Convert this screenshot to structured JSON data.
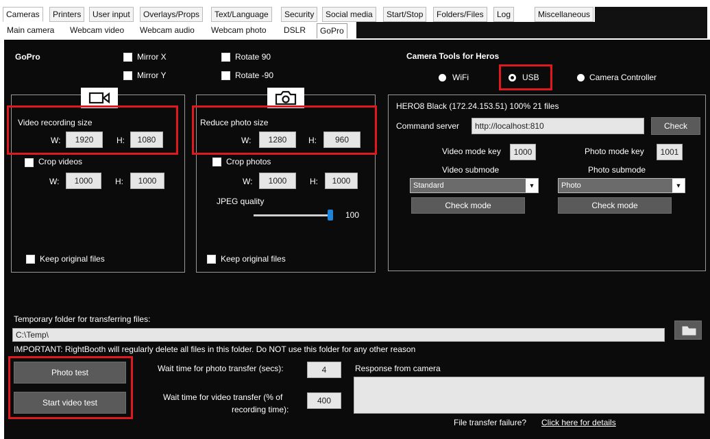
{
  "tabs_top": [
    "Cameras",
    "Printers",
    "User input",
    "Overlays/Props",
    "Text/Language",
    "Security",
    "Social media",
    "Start/Stop",
    "Folders/Files",
    "Log",
    "Miscellaneous"
  ],
  "tabs_sub": [
    "Main camera",
    "Webcam video",
    "Webcam audio",
    "Webcam photo",
    "DSLR",
    "GoPro"
  ],
  "gopro": {
    "title": "GoPro",
    "mirror_x": "Mirror X",
    "mirror_y": "Mirror Y",
    "rotate_90": "Rotate 90",
    "rotate_m90": "Rotate -90"
  },
  "video": {
    "size_label": "Video recording size",
    "w_label": "W:",
    "w_value": "1920",
    "h_label": "H:",
    "h_value": "1080",
    "crop_label": "Crop videos",
    "crop_w_label": "W:",
    "crop_w": "1000",
    "crop_h_label": "H:",
    "crop_h": "1000",
    "keep_label": "Keep original files"
  },
  "photo": {
    "size_label": "Reduce photo size",
    "w_label": "W:",
    "w_value": "1280",
    "h_label": "H:",
    "h_value": "960",
    "crop_label": "Crop photos",
    "crop_w_label": "W:",
    "crop_w": "1000",
    "crop_h_label": "H:",
    "crop_h": "1000",
    "jpeg_label": "JPEG quality",
    "jpeg_value": "100",
    "jpeg_fraction": 1.0,
    "keep_label": "Keep original files"
  },
  "tools": {
    "title": "Camera Tools for Heros",
    "wifi": "WiFi",
    "usb": "USB",
    "controller": "Camera Controller",
    "status": "HERO8 Black (172.24.153.51)   100%   21 files",
    "cmd_label": "Command server",
    "cmd_value": "http://localhost:810",
    "check_btn": "Check",
    "video_key_label": "Video mode key",
    "video_key": "1000",
    "photo_key_label": "Photo mode key",
    "photo_key": "1001",
    "video_submode_label": "Video submode",
    "video_submode": "Standard",
    "photo_submode_label": "Photo submode",
    "photo_submode": "Photo",
    "check_mode": "Check mode"
  },
  "temp": {
    "label": "Temporary folder for transferring files:",
    "path": "C:\\Temp\\",
    "warning": "IMPORTANT: RightBooth will regularly delete all files in this folder. Do NOT use this folder for any other reason"
  },
  "bottom": {
    "photo_test": "Photo test",
    "video_test": "Start video test",
    "wait_photo_label": "Wait time for photo transfer (secs):",
    "wait_photo": "4",
    "wait_video_label_1": "Wait time for video transfer (% of",
    "wait_video_label_2": "recording time):",
    "wait_video": "400",
    "response_label": "Response from camera",
    "failure_text": "File transfer failure?",
    "failure_link": "Click here for details"
  }
}
